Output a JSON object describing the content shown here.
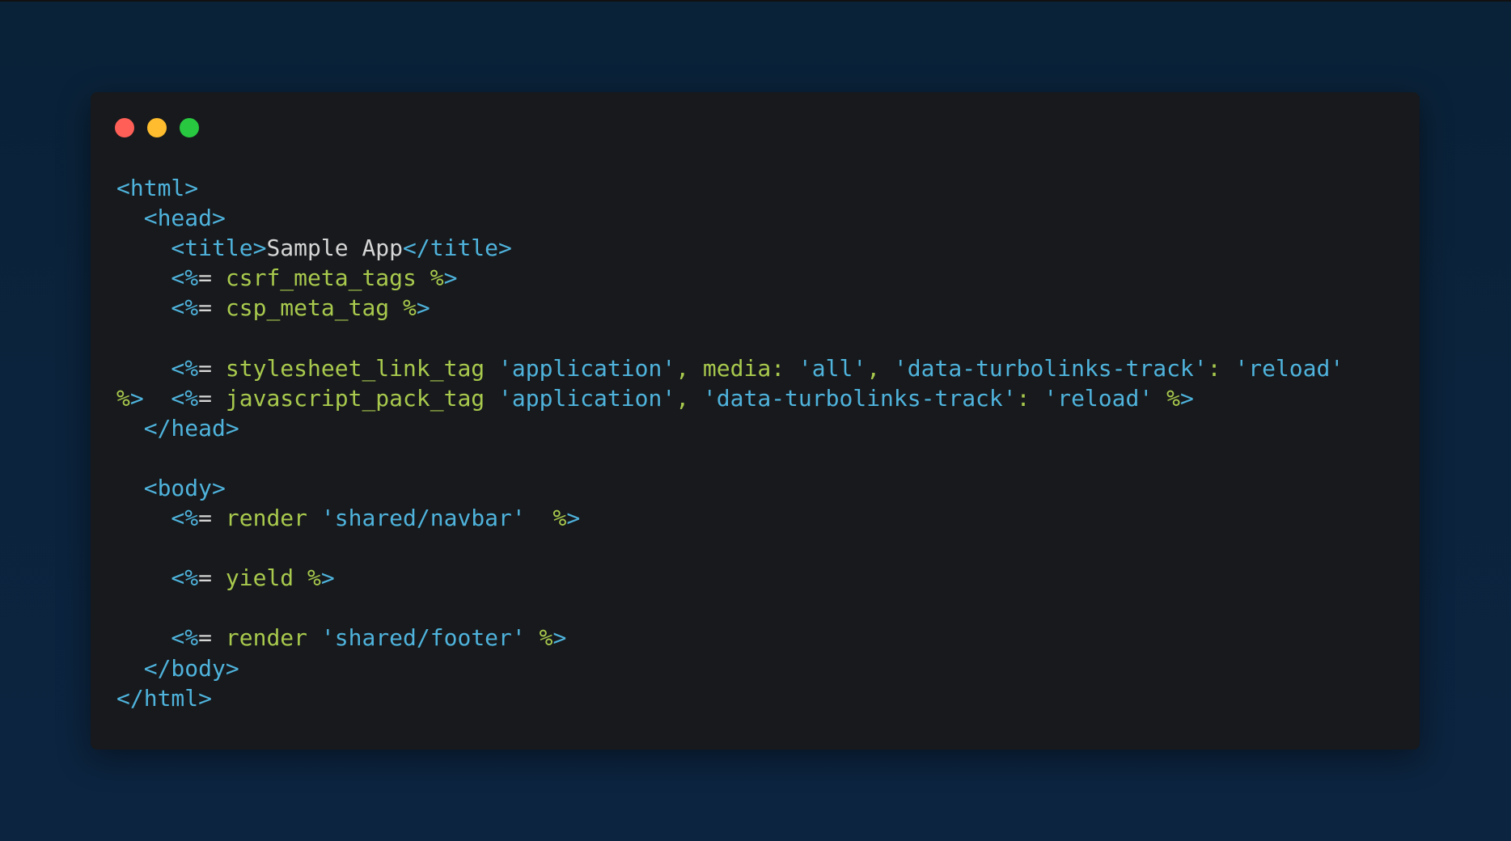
{
  "window": {
    "controls": [
      "close",
      "minimize",
      "maximize"
    ]
  },
  "colors": {
    "tag": "#4fb3dc",
    "ruby": "#a8c94d",
    "text": "#d6d6d6",
    "close": "#ff5f57",
    "minimize": "#febc2e",
    "maximize": "#28c840"
  },
  "code_lines": [
    [
      [
        "<html>",
        "b"
      ]
    ],
    [
      [
        "  <head>",
        "b"
      ]
    ],
    [
      [
        "    <title>",
        "b"
      ],
      [
        "Sample App",
        "w"
      ],
      [
        "</title>",
        "b"
      ]
    ],
    [
      [
        "    <%",
        "b"
      ],
      [
        "= ",
        "w"
      ],
      [
        "csrf_meta_tags ",
        "g"
      ],
      [
        "%",
        "g"
      ],
      [
        ">",
        "b"
      ]
    ],
    [
      [
        "    <%",
        "b"
      ],
      [
        "= ",
        "w"
      ],
      [
        "csp_meta_tag ",
        "g"
      ],
      [
        "%",
        "g"
      ],
      [
        ">",
        "b"
      ]
    ],
    [],
    [
      [
        "    <%",
        "b"
      ],
      [
        "= ",
        "w"
      ],
      [
        "stylesheet_link_tag ",
        "g"
      ],
      [
        "'application'",
        "b"
      ],
      [
        ", media: ",
        "g"
      ],
      [
        "'all'",
        "b"
      ],
      [
        ", ",
        "g"
      ],
      [
        "'data-turbolinks-track'",
        "b"
      ],
      [
        ": ",
        "g"
      ],
      [
        "'reload'",
        "b"
      ]
    ],
    [
      [
        "%",
        "g"
      ],
      [
        ">",
        "b"
      ],
      [
        "  <%",
        "b"
      ],
      [
        "= ",
        "w"
      ],
      [
        "javascript_pack_tag ",
        "g"
      ],
      [
        "'application'",
        "b"
      ],
      [
        ", ",
        "g"
      ],
      [
        "'data-turbolinks-track'",
        "b"
      ],
      [
        ": ",
        "g"
      ],
      [
        "'reload'",
        "b"
      ],
      [
        " %",
        "g"
      ],
      [
        ">",
        "b"
      ]
    ],
    [
      [
        "  </head>",
        "b"
      ]
    ],
    [],
    [
      [
        "  <body>",
        "b"
      ]
    ],
    [
      [
        "    <%",
        "b"
      ],
      [
        "= ",
        "w"
      ],
      [
        "render ",
        "g"
      ],
      [
        "'shared/navbar'",
        "b"
      ],
      [
        "  %",
        "g"
      ],
      [
        ">",
        "b"
      ]
    ],
    [],
    [
      [
        "    <%",
        "b"
      ],
      [
        "= ",
        "w"
      ],
      [
        "yield ",
        "g"
      ],
      [
        "%",
        "g"
      ],
      [
        ">",
        "b"
      ]
    ],
    [],
    [
      [
        "    <%",
        "b"
      ],
      [
        "= ",
        "w"
      ],
      [
        "render ",
        "g"
      ],
      [
        "'shared/footer'",
        "b"
      ],
      [
        " %",
        "g"
      ],
      [
        ">",
        "b"
      ]
    ],
    [
      [
        "  </body>",
        "b"
      ]
    ],
    [
      [
        "</html>",
        "b"
      ]
    ]
  ]
}
